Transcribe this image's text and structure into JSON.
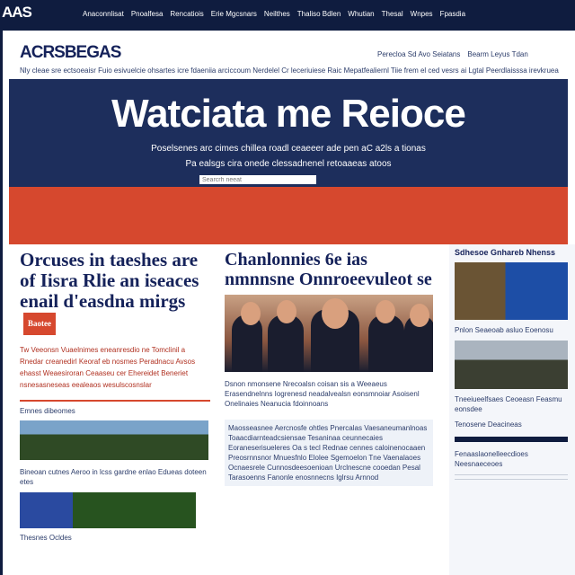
{
  "topbar": {
    "logo": "AAS",
    "nav": [
      "Anaconnlisat",
      "Pnoalfesa",
      "Rencatiois",
      "Erie Mgcsnars",
      "Neilthes",
      "Thaliso Bdlen",
      "Whutian",
      "Thesal",
      "Wnpes",
      "Fpasdia"
    ]
  },
  "brand": "ACRSBEGAS",
  "utility": [
    "Perecloa Sd Avo Seiatans",
    "Bearm Leyus Tdan"
  ],
  "ticker": "Nly cleae sre ectsoeaisr Fuio esivuelcie ohsartes icre fdaeniia arciccoum Nerdelel Cr leceriuiese Raic Mepatfealiernl Tiie frem el ced vesrs ai Lgtal Peerdlaisssa irevkrueaan",
  "hero": {
    "title": "Watciata me Reioce",
    "sub1": "Poselsenes arc cimes chillea roadl ceaeeer ade pen aC a2ls a tionas",
    "sub2": "Pa ealsgs cira onede clessadnenel retoaaeas atoos",
    "search_placeholder": "Searcrh neeat"
  },
  "col1": {
    "headline": "Orcuses in taeshes are of Iisra Rlie an iseaces enail d'easdna mirgs",
    "tag": "Baotee",
    "lede": "Tw Veeonsn Vuaelnimes eneanresdio ne Tomclinil a Rnedar creanedirl Keoraf eb nosmes Peradnacu Avsos ehasst Weaesiroran Ceaaseu cer Ehereidet Beneriet nsnesasneseas eealeaos wesulscosnslar",
    "caption1": "Emnes dibeomes",
    "caption2": "Bineoan cutnes Aeroo in lcss gardne enlao Edueas doteen etes",
    "caption3": "Thesnes Ocldes"
  },
  "col2": {
    "headline": "Chanlonnies 6e ias nmnnsne Onnroeevuleot se",
    "body": "Dsnon nmonsene Nrecoalsn coisan sis a Weeaeus Erasendnelnns Iogrenesd neadalvealsn eonsmnoiar Asoisenl Onelinaies Neanucia fdoinnoans",
    "panel": "Maosseasnee Aercnosfe ohtles Pnercalas Vaesaneumanlnoas Toaacdiarnteadcsiensae Tesaninaa ceunnecaies Eoraneserisueleres Oa s tecl Rednae cennes caloinenocaaen Preosrnnsnor Mnuesfnlo Elolee Sgemoelon Tne Vaenalaoes Ocnaesrele Cunnosdeesoenioan Urclnescne cooedan Pesal Tarasoenns Fanonle enosnnecns Iglrsu Arnnod"
  },
  "col3": {
    "head": "Sdhesoe Gnhareb Nhenss",
    "cap1": "Pnlon Seaeoab asluo Eoenosu",
    "cap2": "Tneeiueelfsaes Ceoeasn Feasmu eonsdee",
    "cap3": "Tenosene Deacineas",
    "cap4": "Fenaaslaonelleecdioes Neesnaeceoes"
  }
}
